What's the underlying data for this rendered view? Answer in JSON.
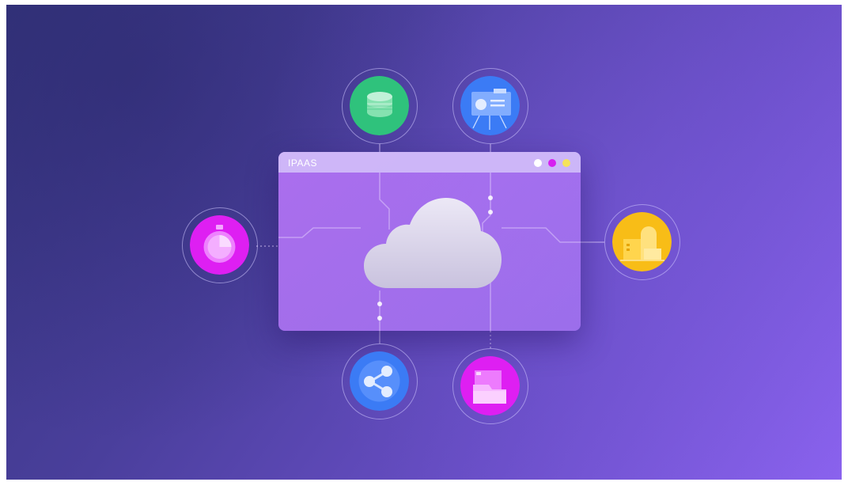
{
  "window": {
    "title": "IPAAS"
  },
  "icons": {
    "top_left": "coins-stack-icon",
    "top_right": "presentation-board-icon",
    "left": "stopwatch-icon",
    "right": "storage-boxes-icon",
    "bottom_left": "share-network-icon",
    "bottom_right": "document-tray-icon",
    "center": "cloud-icon"
  },
  "colors": {
    "green": "#2fc27c",
    "blue": "#3b7bf5",
    "magenta": "#de1ff2",
    "yellow": "#f8bd17",
    "background_start": "#36357f",
    "background_end": "#8a62ee"
  }
}
